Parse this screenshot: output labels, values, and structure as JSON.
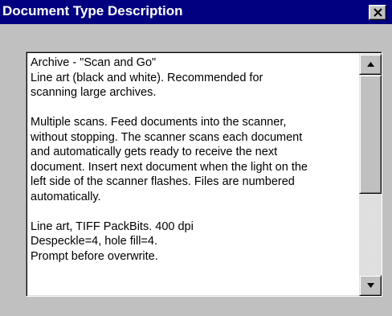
{
  "window": {
    "title": "Document Type Description",
    "close_icon": "close-x-icon"
  },
  "description": {
    "lines_block1": [
      "Archive - \"Scan and Go\"",
      "Line art (black and white). Recommended for",
      "scanning large archives."
    ],
    "lines_block2": [
      "Multiple scans.  Feed documents into the scanner,",
      "without stopping.  The scanner scans each document",
      "and automatically gets ready to receive the next",
      "document. Insert next document when the light on the",
      "left side of the scanner flashes.  Files are numbered",
      "automatically."
    ],
    "lines_block3": [
      "Line art, TIFF PackBits. 400 dpi",
      "Despeckle=4, hole fill=4.",
      "Prompt before overwrite."
    ]
  },
  "scrollbar": {
    "up_icon": "arrow-up-icon",
    "down_icon": "arrow-down-icon",
    "position_fraction": 0
  },
  "colors": {
    "titlebar": "#000080",
    "dialog_bg": "#c0c0c0"
  }
}
